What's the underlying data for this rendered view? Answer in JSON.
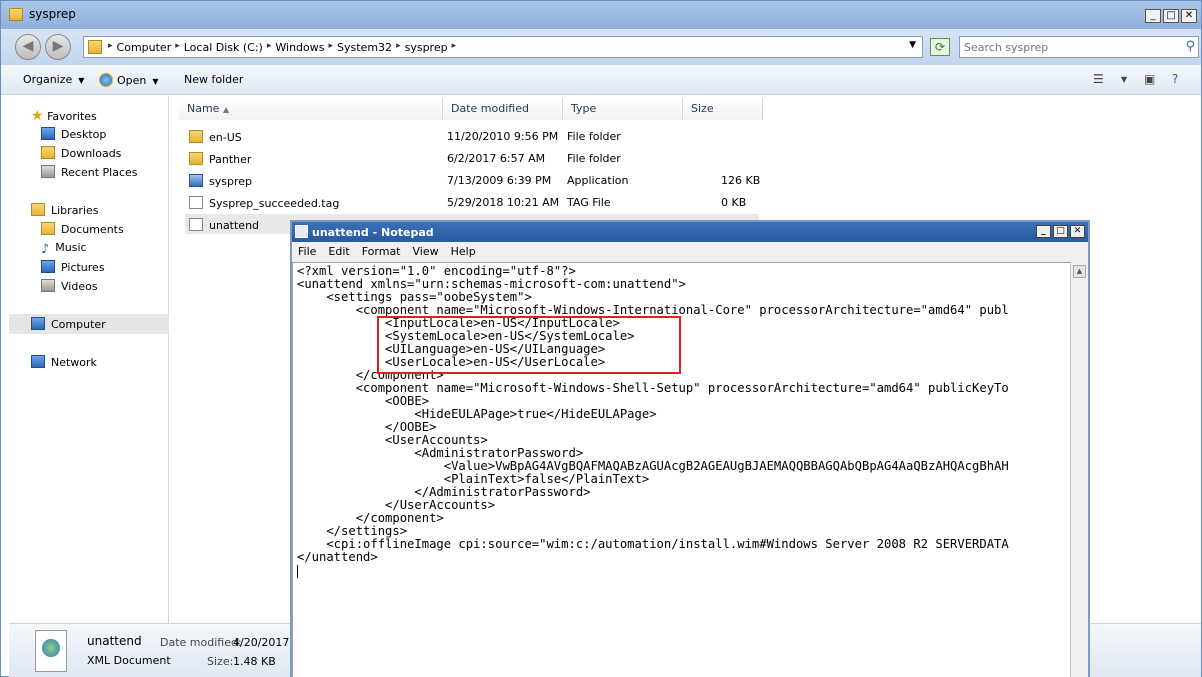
{
  "explorer": {
    "title": "sysprep",
    "window_buttons": [
      "_",
      "□",
      "✕"
    ],
    "address": {
      "breadcrumbs": [
        "Computer",
        "Local Disk (C:)",
        "Windows",
        "System32",
        "sysprep"
      ]
    },
    "search": {
      "placeholder": "Search sysprep"
    },
    "toolbar": {
      "organize": "Organize",
      "open": "Open",
      "new_folder": "New folder"
    },
    "nav": {
      "favorites": "Favorites",
      "desktop": "Desktop",
      "downloads": "Downloads",
      "recent_places": "Recent Places",
      "libraries": "Libraries",
      "documents": "Documents",
      "music": "Music",
      "pictures": "Pictures",
      "videos": "Videos",
      "computer": "Computer",
      "network": "Network"
    },
    "columns": {
      "name": "Name",
      "date_modified": "Date modified",
      "type": "Type",
      "size": "Size"
    },
    "files": [
      {
        "name": "en-US",
        "date": "11/20/2010 9:56 PM",
        "type": "File folder",
        "size": ""
      },
      {
        "name": "Panther",
        "date": "6/2/2017 6:57 AM",
        "type": "File folder",
        "size": ""
      },
      {
        "name": "sysprep",
        "date": "7/13/2009 6:39 PM",
        "type": "Application",
        "size": "126 KB"
      },
      {
        "name": "Sysprep_succeeded.tag",
        "date": "5/29/2018 10:21 AM",
        "type": "TAG File",
        "size": "0 KB"
      },
      {
        "name": "unattend",
        "date": "",
        "type": "",
        "size": ""
      }
    ],
    "details": {
      "name": "unattend",
      "type": "XML Document",
      "date_label": "Date modified:",
      "date_value": "4/20/2017 :",
      "size_label": "Size:",
      "size_value": "1.48 KB"
    }
  },
  "notepad": {
    "title": "unattend - Notepad",
    "menu": [
      "File",
      "Edit",
      "Format",
      "View",
      "Help"
    ],
    "lines": [
      "<?xml version=\"1.0\" encoding=\"utf-8\"?>",
      "<unattend xmlns=\"urn:schemas-microsoft-com:unattend\">",
      "    <settings pass=\"oobeSystem\">",
      "        <component name=\"Microsoft-Windows-International-Core\" processorArchitecture=\"amd64\" publ",
      "            <InputLocale>en-US</InputLocale>",
      "            <SystemLocale>en-US</SystemLocale>",
      "            <UILanguage>en-US</UILanguage>",
      "            <UserLocale>en-US</UserLocale>",
      "        </component>",
      "        <component name=\"Microsoft-Windows-Shell-Setup\" processorArchitecture=\"amd64\" publicKeyTo",
      "            <OOBE>",
      "                <HideEULAPage>true</HideEULAPage>",
      "            </OOBE>",
      "            <UserAccounts>",
      "                <AdministratorPassword>",
      "                    <Value>VwBpAG4AVgBQAFMAQABzAGUAcgB2AGEAUgBJAEMAQQBBAGQAbQBpAG4AaQBzAHQAcgBhAH",
      "                    <PlainText>false</PlainText>",
      "                </AdministratorPassword>",
      "            </UserAccounts>",
      "        </component>",
      "    </settings>",
      "    <cpi:offlineImage cpi:source=\"wim:c:/automation/install.wim#Windows Server 2008 R2 SERVERDATA",
      "</unattend>"
    ]
  }
}
